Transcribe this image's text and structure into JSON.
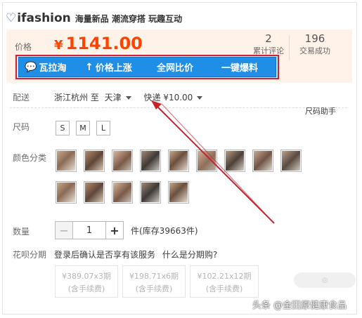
{
  "header": {
    "logo_text": "ifashion",
    "slogan": "海量新品 潮流穿搭 玩趣互动"
  },
  "price": {
    "label": "价格",
    "currency": "¥",
    "amount": "1141.00",
    "accent_color": "#ff4400"
  },
  "stats": [
    {
      "number": "2",
      "label": "累计评论"
    },
    {
      "number": "196",
      "label": "交易成功"
    }
  ],
  "plugin_bar": {
    "items": [
      {
        "icon": "chat-icon",
        "label": "瓦拉淘"
      },
      {
        "icon": "arrow-up-icon",
        "label": "价格上涨"
      },
      {
        "icon": "",
        "label": "全网比价"
      },
      {
        "icon": "",
        "label": "一键爆料"
      }
    ],
    "color": "#1f8ee6"
  },
  "delivery": {
    "label": "配送",
    "from": "浙江杭州 至",
    "to": "天津",
    "shipping": "快递 ¥10.00"
  },
  "size_helper": "尺码助手",
  "size": {
    "label": "尺码",
    "options": [
      "S",
      "M",
      "L"
    ]
  },
  "color": {
    "label": "颜色分类"
  },
  "quantity": {
    "label": "数量",
    "minus": "−",
    "value": "1",
    "plus": "+",
    "stock": "件(库存39663件)"
  },
  "installment": {
    "label": "花呗分期",
    "text": "登录后确认是否享有该服务",
    "link": "什么是分期购?",
    "options": [
      {
        "amount": "¥389.07x3期",
        "fee": "(含手续费)"
      },
      {
        "amount": "¥198.71x6期",
        "fee": "(含手续费)"
      },
      {
        "amount": "¥102.21x12期",
        "fee": "(含手续费)"
      }
    ]
  },
  "watermark": "头条 @金田原健康食品"
}
